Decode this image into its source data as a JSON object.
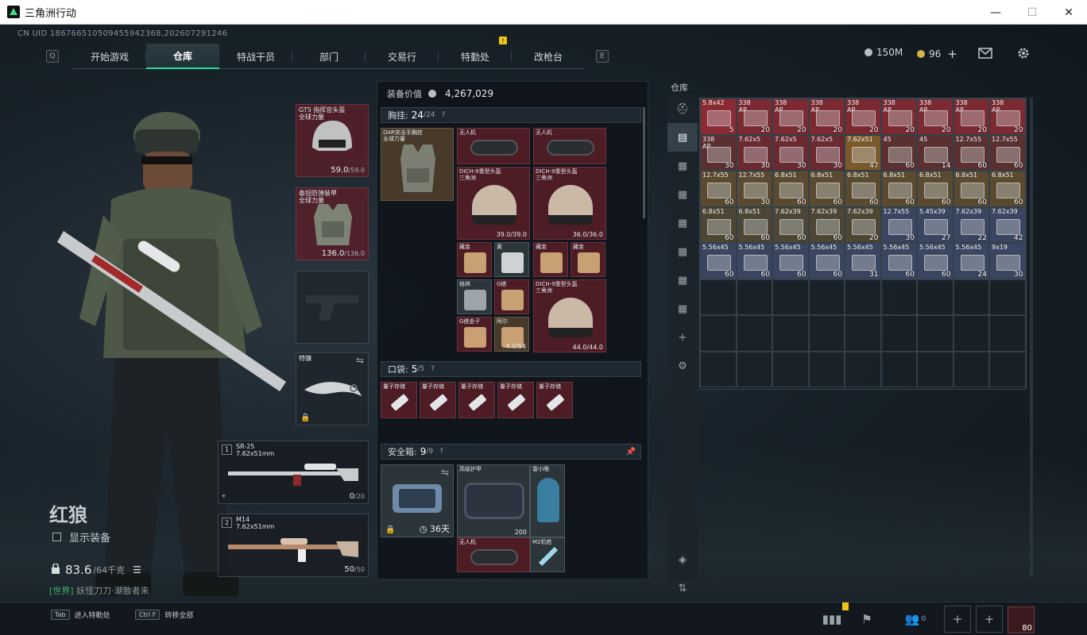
{
  "window": {
    "title": "三角洲行动",
    "minimize": "—",
    "maximize": "☐",
    "close": "✕"
  },
  "uid": "CN UID 1867665105094559423​68,202607291246",
  "nav": {
    "left_key": "Q",
    "right_key": "E",
    "tabs": [
      "开始游戏",
      "仓库",
      "特战干员",
      "部门",
      "交易行",
      "特勤处",
      "改枪台"
    ],
    "active_tab": "仓库",
    "notify_mark": "!"
  },
  "currency": {
    "silver": "150M",
    "gold": "96",
    "gold_add": "+"
  },
  "operator": {
    "name": "红狼",
    "show_gear_label": "显示装备",
    "weight_value": "83.6",
    "weight_cap": "/64千克"
  },
  "chat": {
    "channel": "[世界]",
    "message": "妖怪刀刀·潮散者来"
  },
  "equip": {
    "helmet": {
      "label1": "GT5 指挥官头盔",
      "label2": "全球力量",
      "dur": "59.0",
      "dur_max": "/59.0"
    },
    "armor": {
      "label1": "泰坦防弹装甲",
      "label2": "全球力量",
      "dur": "136.0",
      "dur_max": "/136.0"
    },
    "melee": {
      "label": "特镰"
    },
    "primary": {
      "num": "1",
      "name": "SR-25",
      "caliber": "7.62x51mm",
      "ammo": "0",
      "ammo_max": "/20"
    },
    "secondary": {
      "num": "2",
      "name": "M14",
      "caliber": "7.62x51mm",
      "ammo": "50",
      "ammo_max": "/50"
    }
  },
  "mid": {
    "value_label": "装备价值",
    "value": "4,267,029",
    "chest": {
      "label": "胸挂:",
      "count": "24",
      "cap": "/24",
      "q": "?",
      "rig_label1": "DAR突击手胸挂",
      "rig_label2": "全球力量",
      "items": [
        {
          "lbl": "无人机",
          "dur": ""
        },
        {
          "lbl": "无人机",
          "dur": ""
        },
        {
          "lbl": "DICH-9重型头盔",
          "lbl2": "三角洲",
          "dur": "39.0/39.0"
        },
        {
          "lbl": "DICH-9重型头盔",
          "lbl2": "三角洲",
          "dur": "36.0/36.0"
        },
        {
          "lbl": "藏金",
          "dur": ""
        },
        {
          "lbl": "黄",
          "dur": ""
        },
        {
          "lbl": "藏金",
          "dur": ""
        },
        {
          "lbl": "藏金",
          "dur": ""
        },
        {
          "lbl": "格林",
          "dur": ""
        },
        {
          "lbl": "G搭",
          "dur": ""
        },
        {
          "lbl": "DICH-9重型头盔",
          "lbl2": "三角洲",
          "dur": "44.0/44.0"
        },
        {
          "lbl": "G搭金子",
          "dur": ""
        },
        {
          "lbl": "阿尔",
          "dur": "4.0/54"
        }
      ]
    },
    "pocket": {
      "label": "口袋:",
      "count": "5",
      "cap": "/5",
      "q": "?",
      "items": [
        "量子存储",
        "量子存储",
        "量子存储",
        "量子存储",
        "量子存储"
      ]
    },
    "safebox": {
      "label": "安全箱:",
      "count": "9",
      "cap": "/9",
      "q": "?",
      "timer": "36天",
      "items": [
        {
          "lbl": "高级护甲",
          "dur": "200"
        },
        {
          "lbl": "雷小眼",
          "dur": ""
        },
        {
          "lbl": "无人机",
          "dur": ""
        },
        {
          "lbl": "M2机枪",
          "dur": ""
        }
      ]
    }
  },
  "storage": {
    "title": "仓库",
    "rows": [
      [
        {
          "l": "5.8x42",
          "s": "",
          "c": "5",
          "color": "#8a2a32"
        },
        {
          "l": "338",
          "s": "AP",
          "c": "20",
          "color": "#7a2a30"
        },
        {
          "l": "338",
          "s": "AP",
          "c": "20",
          "color": "#7a2a30"
        },
        {
          "l": "338",
          "s": "AP",
          "c": "20",
          "color": "#7a2a30"
        },
        {
          "l": "338",
          "s": "AP",
          "c": "20",
          "color": "#7a2a30"
        },
        {
          "l": "338",
          "s": "AP",
          "c": "20",
          "color": "#7a2a30"
        },
        {
          "l": "338",
          "s": "AP",
          "c": "20",
          "color": "#7a2a30"
        },
        {
          "l": "338",
          "s": "AP",
          "c": "20",
          "color": "#7a2a30"
        },
        {
          "l": "338",
          "s": "AP",
          "c": "20",
          "color": "#7a2a30"
        }
      ],
      [
        {
          "l": "338",
          "s": "AP",
          "c": "30",
          "color": "#5c3030"
        },
        {
          "l": "7.62x5",
          "s": "",
          "c": "30",
          "color": "#6a2a30"
        },
        {
          "l": "7.62x5",
          "s": "",
          "c": "30",
          "color": "#6a2a30"
        },
        {
          "l": "7.62x5",
          "s": "",
          "c": "30",
          "color": "#6a2a30"
        },
        {
          "l": "7.62x51",
          "s": "",
          "c": "47",
          "color": "#7a5a2a"
        },
        {
          "l": "45",
          "s": "",
          "c": "60",
          "color": "#5a3030"
        },
        {
          "l": "45",
          "s": "",
          "c": "14",
          "color": "#5a3030"
        },
        {
          "l": "12.7x55",
          "s": "",
          "c": "60",
          "color": "#5a3030"
        },
        {
          "l": "12.7x55",
          "s": "",
          "c": "60",
          "color": "#5a3030"
        }
      ],
      [
        {
          "l": "12.7x55",
          "s": "",
          "c": "60",
          "color": "#5a4a30"
        },
        {
          "l": "12.7x55",
          "s": "",
          "c": "30",
          "color": "#5a4a30"
        },
        {
          "l": "6.8x51",
          "s": "",
          "c": "60",
          "color": "#5a4a30"
        },
        {
          "l": "6.8x51",
          "s": "",
          "c": "60",
          "color": "#5a4a30"
        },
        {
          "l": "6.8x51",
          "s": "",
          "c": "60",
          "color": "#5a4a30"
        },
        {
          "l": "6.8x51",
          "s": "",
          "c": "60",
          "color": "#5a4a30"
        },
        {
          "l": "6.8x51",
          "s": "",
          "c": "60",
          "color": "#5a4a30"
        },
        {
          "l": "6.8x51",
          "s": "",
          "c": "60",
          "color": "#5a4a30"
        },
        {
          "l": "6.8x51",
          "s": "",
          "c": "60",
          "color": "#5a4a30"
        }
      ],
      [
        {
          "l": "6.8x51",
          "s": "",
          "c": "60",
          "color": "#4e4634"
        },
        {
          "l": "6.8x51",
          "s": "",
          "c": "60",
          "color": "#4e4634"
        },
        {
          "l": "7.62x39",
          "s": "",
          "c": "60",
          "color": "#4e4634"
        },
        {
          "l": "7.62x39",
          "s": "",
          "c": "60",
          "color": "#4e4634"
        },
        {
          "l": "7.62x39",
          "s": "",
          "c": "20",
          "color": "#4e4634"
        },
        {
          "l": "12.7x55",
          "s": "",
          "c": "30",
          "color": "#3a4660"
        },
        {
          "l": "5.45x39",
          "s": "",
          "c": "27",
          "color": "#3a4660"
        },
        {
          "l": "7.62x39",
          "s": "",
          "c": "22",
          "color": "#3a4660"
        },
        {
          "l": "7.62x39",
          "s": "",
          "c": "42",
          "color": "#3a4660"
        }
      ],
      [
        {
          "l": "5.56x45",
          "s": "",
          "c": "60",
          "color": "#3a4660"
        },
        {
          "l": "5.56x45",
          "s": "",
          "c": "60",
          "color": "#3a4660"
        },
        {
          "l": "5.56x45",
          "s": "",
          "c": "60",
          "color": "#3a4660"
        },
        {
          "l": "5.56x45",
          "s": "",
          "c": "60",
          "color": "#3a4660"
        },
        {
          "l": "5.56x45",
          "s": "",
          "c": "31",
          "color": "#3a4660"
        },
        {
          "l": "5.56x45",
          "s": "",
          "c": "60",
          "color": "#3a4660"
        },
        {
          "l": "5.56x45",
          "s": "",
          "c": "60",
          "color": "#3a4660"
        },
        {
          "l": "5.56x45",
          "s": "",
          "c": "24",
          "color": "#3a4660"
        },
        {
          "l": "9x19",
          "s": "",
          "c": "30",
          "color": "#3a4660"
        }
      ]
    ]
  },
  "bottom": {
    "hint1_key": "Tab",
    "hint1_label": "进入特勤处",
    "hint2_key": "Ctrl F",
    "hint2_label": "转移全部",
    "friends_count": "0",
    "level": "80"
  }
}
